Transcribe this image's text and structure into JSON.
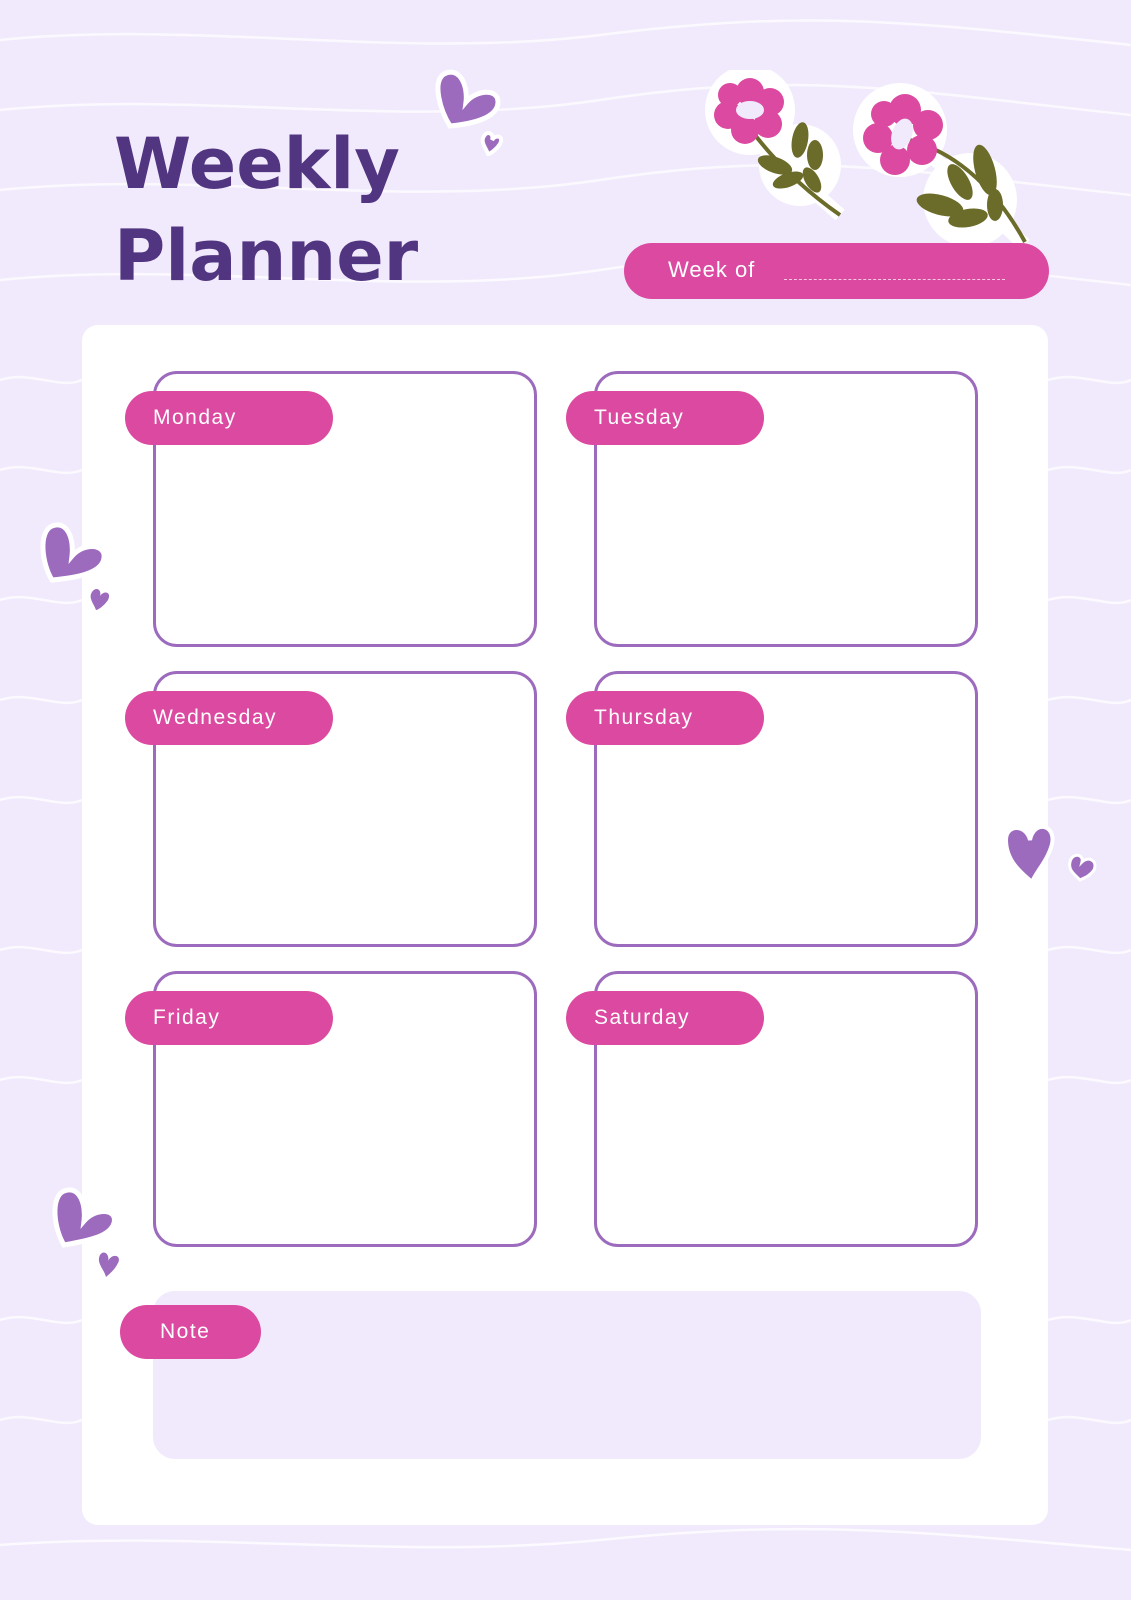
{
  "title": {
    "line1": "Weekly",
    "line2": "Planner"
  },
  "week_of": {
    "label": "Week of",
    "value": ""
  },
  "days": [
    {
      "label": "Monday",
      "content": ""
    },
    {
      "label": "Tuesday",
      "content": ""
    },
    {
      "label": "Wednesday",
      "content": ""
    },
    {
      "label": "Thursday",
      "content": ""
    },
    {
      "label": "Friday",
      "content": ""
    },
    {
      "label": "Saturday",
      "content": ""
    }
  ],
  "note": {
    "label": "Note",
    "content": ""
  },
  "colors": {
    "accent": "#db4aa0",
    "border": "#9c6bbd",
    "title": "#523580",
    "background": "#f1eafc",
    "leaf": "#6b6b2a"
  }
}
